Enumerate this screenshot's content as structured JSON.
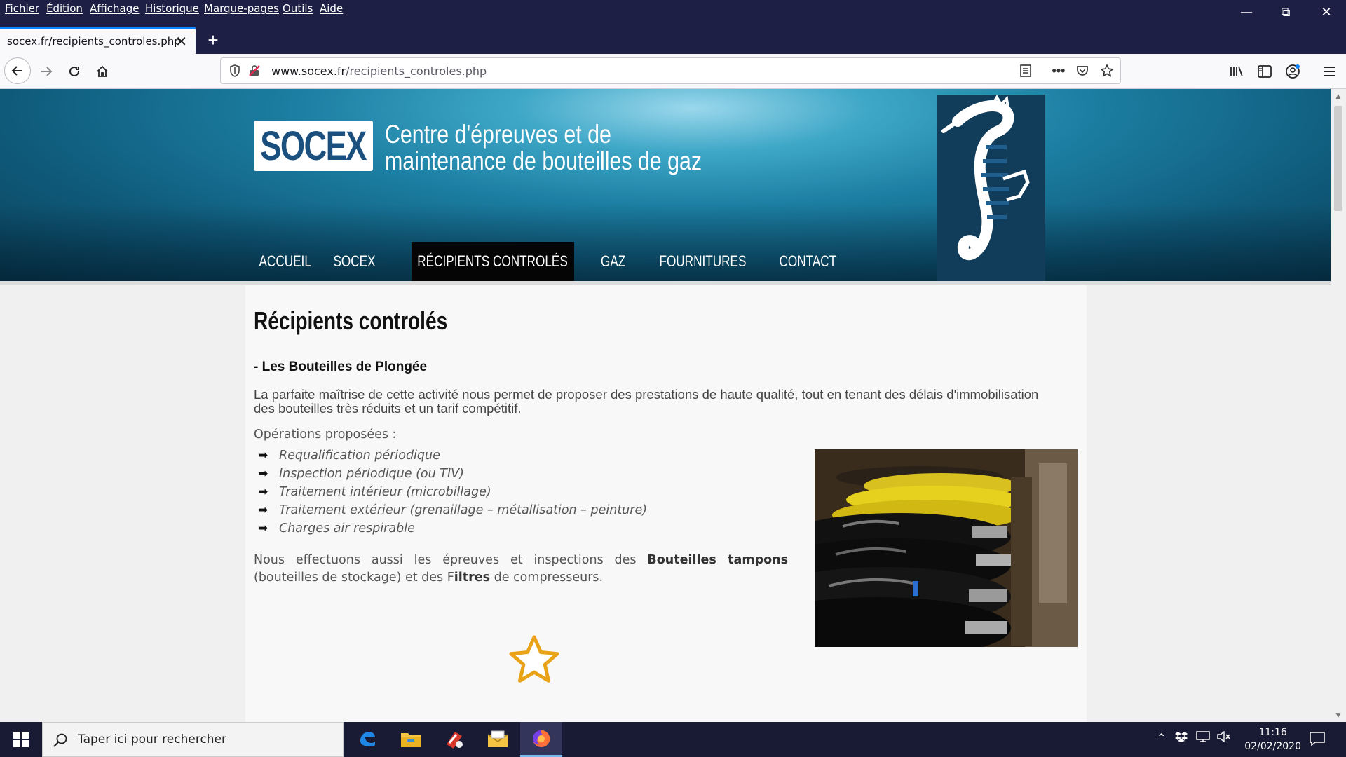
{
  "menubar": {
    "items": [
      "Fichier",
      "Édition",
      "Affichage",
      "Historique",
      "Marque-pages",
      "Outils",
      "Aide"
    ]
  },
  "tab": {
    "title": "socex.fr/recipients_controles.php"
  },
  "urlbar": {
    "domain": "www.socex.fr",
    "path": "/recipients_controles.php"
  },
  "site": {
    "logo": "SOCEX",
    "tagline_line1": "Centre d'épreuves et de",
    "tagline_line2": "maintenance de bouteilles de gaz",
    "nav": [
      "ACCUEIL",
      "SOCEX",
      "RÉCIPIENTS CONTROLÉS",
      "GAZ",
      "FOURNITURES",
      "CONTACT"
    ],
    "active_nav": "RÉCIPIENTS CONTROLÉS"
  },
  "content": {
    "title": "Récipients controlés",
    "section_title": "- Les Bouteilles de Plongée",
    "intro": "La parfaite maîtrise de cette activité nous permet de proposer des prestations de haute qualité, tout en tenant des délais d'immobilisation des bouteilles très réduits et un tarif compétitif.",
    "ops_label": "Opérations proposées :",
    "operations": [
      "Requalification périodique",
      "Inspection périodique (ou TIV)",
      "Traitement intérieur (microbillage)",
      "Traitement extérieur (grenaillage – métallisation – peinture)",
      "Charges air respirable"
    ],
    "extra_1": "Nous effectuons aussi les épreuves et inspections des ",
    "extra_bold_1": "Bouteilles tampons",
    "extra_2": " (bouteilles de stockage) et des F",
    "extra_bold_2": "iltres",
    "extra_3": " de compresseurs."
  },
  "taskbar": {
    "search_placeholder": "Taper ici pour rechercher",
    "time": "11:16",
    "date": "02/02/2020"
  },
  "colors": {
    "chrome_dark": "#1d1f45",
    "accent_blue": "#0a84ff",
    "logo_blue": "#1a4f7e",
    "nav_active_bg": "#050505",
    "star_gold": "#e8a317"
  }
}
